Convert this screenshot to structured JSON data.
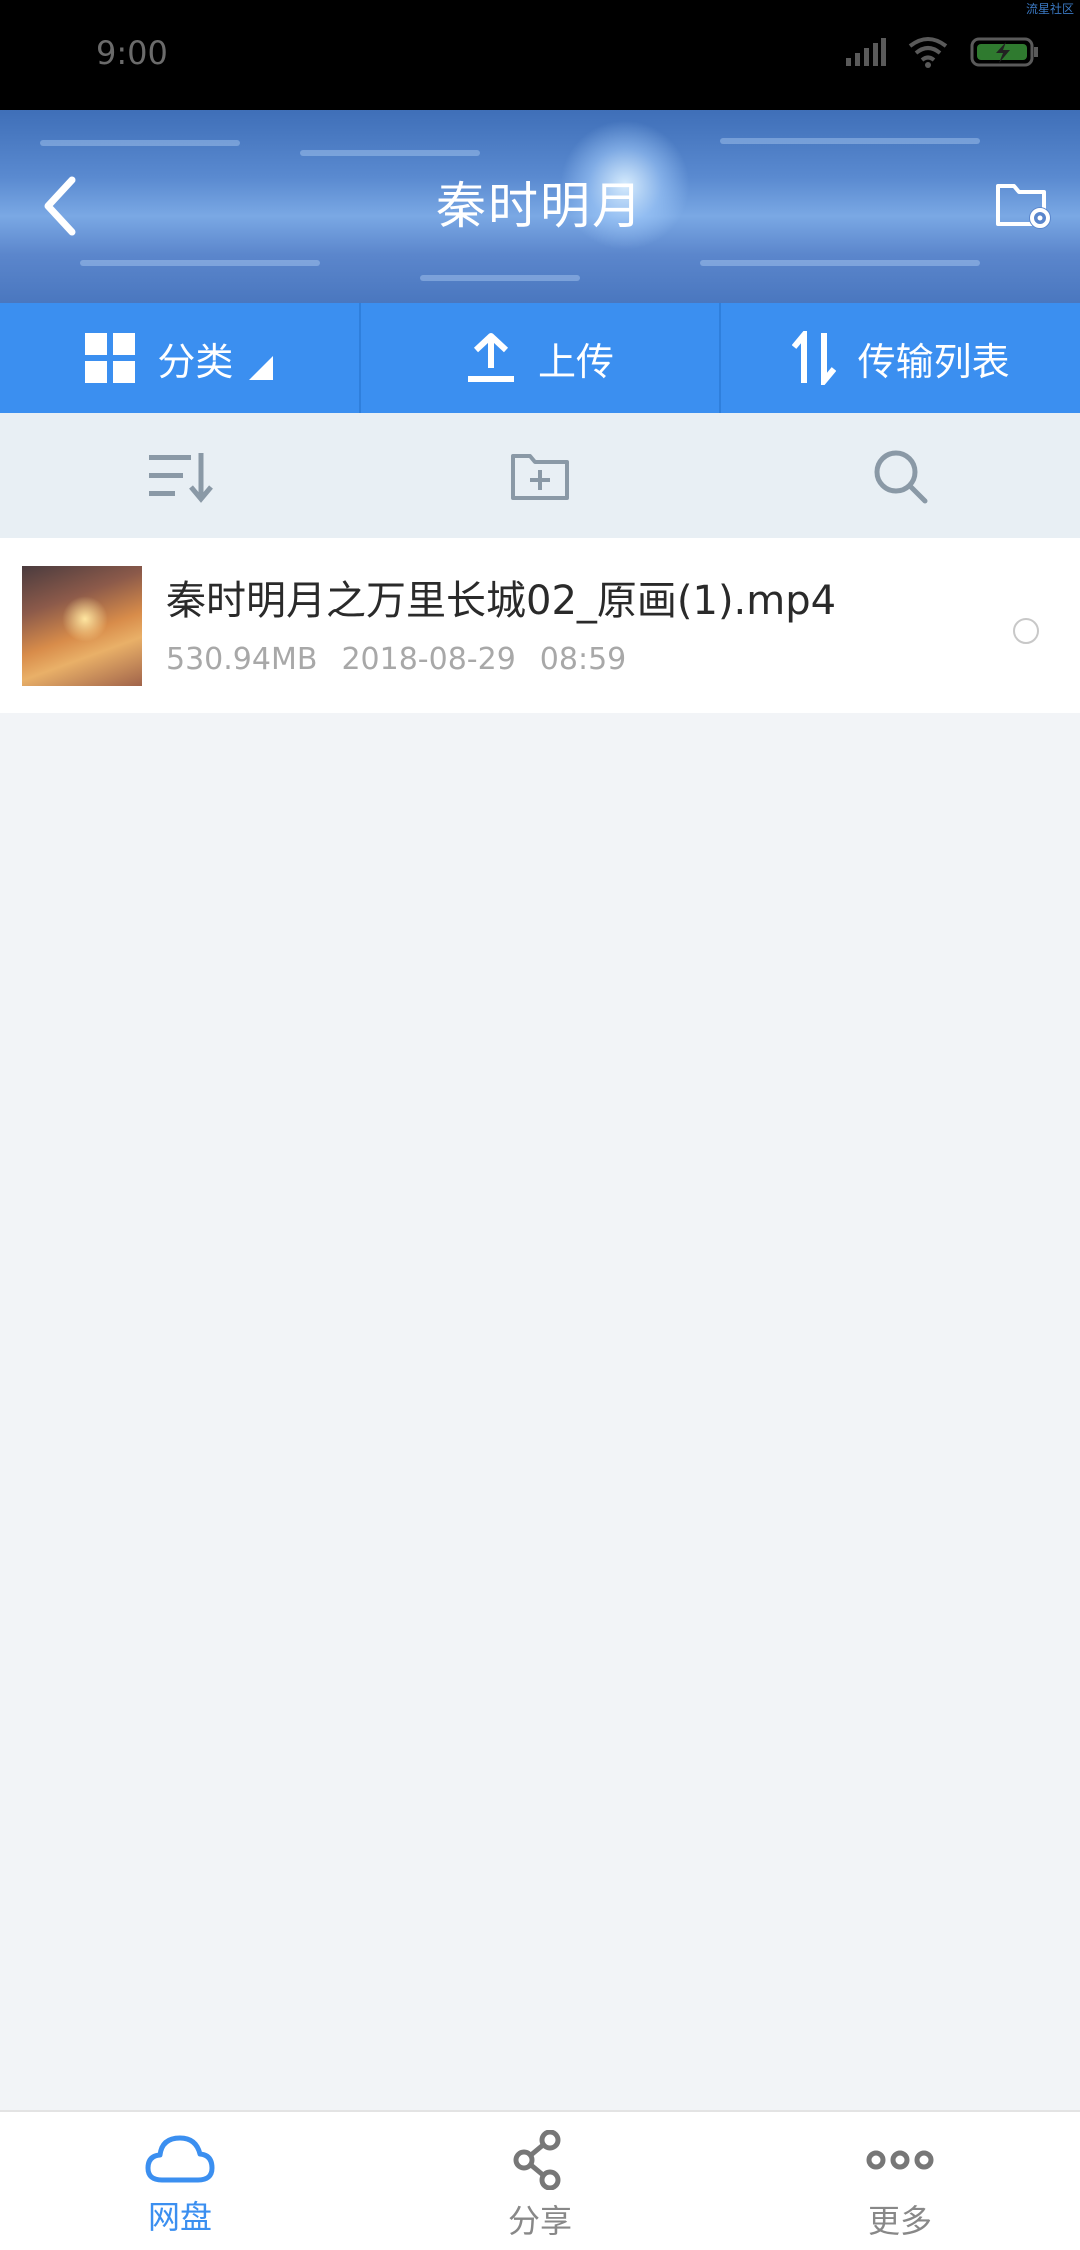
{
  "status_bar": {
    "time": "9:00",
    "corner_text": "流星社区"
  },
  "header": {
    "title": "秦时明月",
    "back_icon": "back-arrow-icon",
    "settings_icon": "folder-settings-icon"
  },
  "toolbar": {
    "category_label": "分类",
    "upload_label": "上传",
    "transfer_label": "传输列表",
    "accent": "#3b8ff0"
  },
  "actions": {
    "sort_icon": "sort-icon",
    "new_folder_icon": "new-folder-icon",
    "search_icon": "search-icon"
  },
  "files": [
    {
      "name": "秦时明月之万里长城02_原画(1).mp4",
      "size": "530.94MB",
      "date": "2018-08-29",
      "time": "08:59"
    }
  ],
  "bottom_nav": [
    {
      "label": "网盘",
      "icon": "cloud-icon",
      "active": true
    },
    {
      "label": "分享",
      "icon": "share-icon",
      "active": false
    },
    {
      "label": "更多",
      "icon": "more-icon",
      "active": false
    }
  ]
}
